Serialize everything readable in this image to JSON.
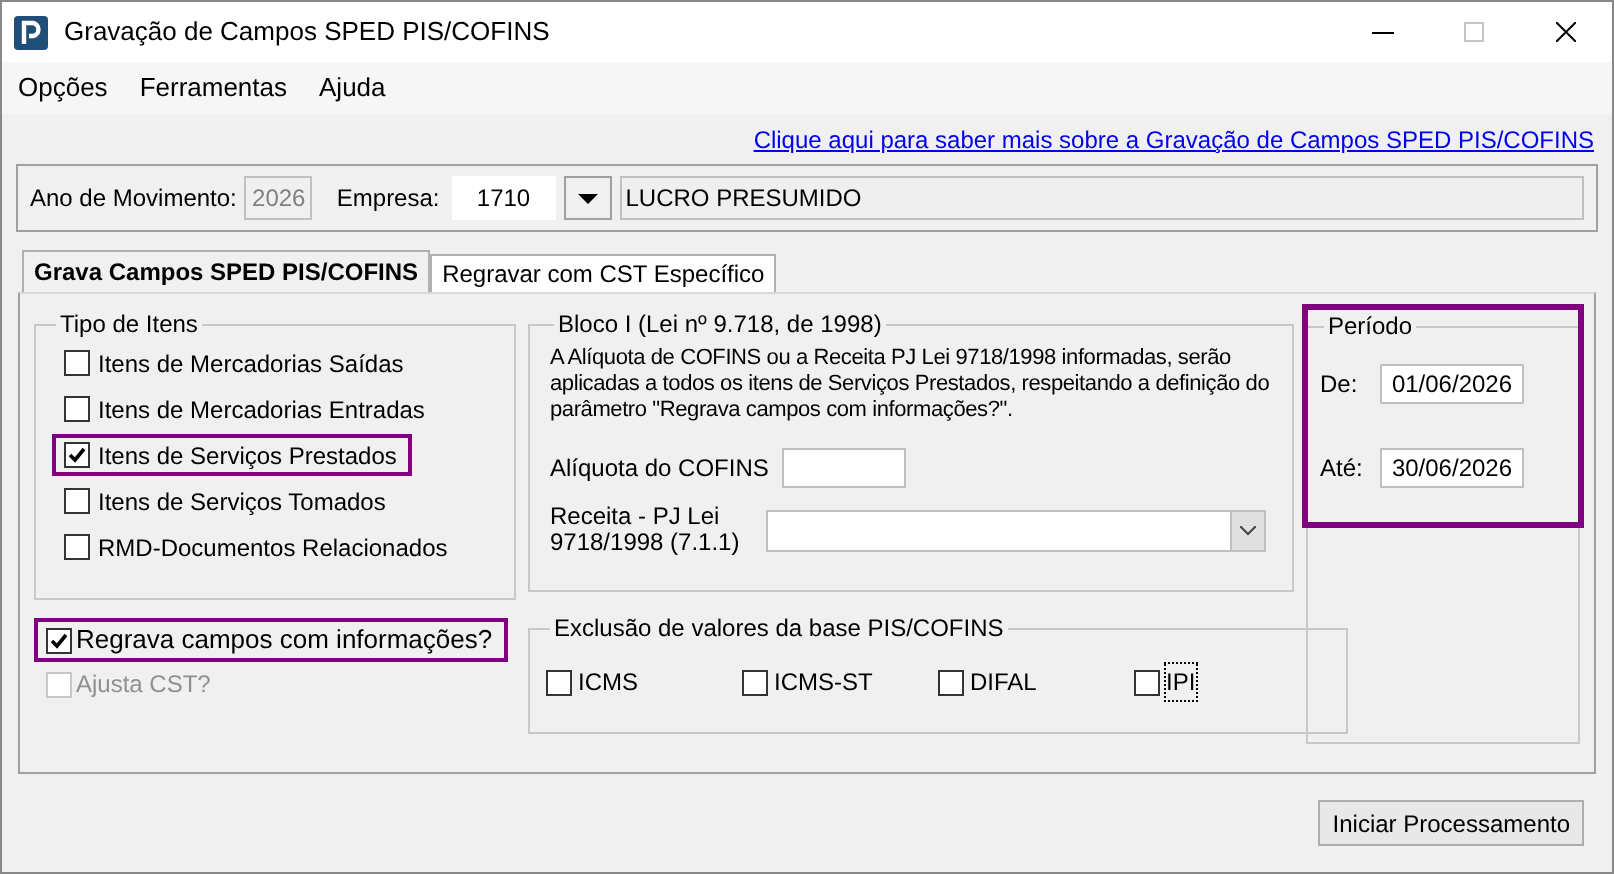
{
  "window": {
    "title": "Gravação de Campos SPED PIS/COFINS"
  },
  "menu": [
    "Opções",
    "Ferramentas",
    "Ajuda"
  ],
  "help_link": "Clique aqui para saber mais sobre a Gravação de Campos SPED PIS/COFINS",
  "header": {
    "ano_label": "Ano de Movimento:",
    "ano_value": "2026",
    "ano_disabled": true,
    "empresa_label": "Empresa:",
    "empresa_value": "1710",
    "empresa_name": "LUCRO PRESUMIDO"
  },
  "tabs": [
    {
      "label": "Grava Campos SPED PIS/COFINS",
      "selected": true
    },
    {
      "label": "Regravar com CST Específico",
      "selected": false
    }
  ],
  "tipo_itens": {
    "title": "Tipo de Itens",
    "items": [
      {
        "label": "Itens de Mercadorias Saídas",
        "checked": false,
        "highlighted": false
      },
      {
        "label": "Itens de Mercadorias Entradas",
        "checked": false,
        "highlighted": false
      },
      {
        "label": "Itens de Serviços Prestados",
        "checked": true,
        "highlighted": true
      },
      {
        "label": "Itens de Serviços Tomados",
        "checked": false,
        "highlighted": false
      },
      {
        "label": "RMD-Documentos Relacionados",
        "checked": false,
        "highlighted": false
      }
    ]
  },
  "options": [
    {
      "label": "Regrava campos com informações?",
      "checked": true,
      "disabled": false,
      "highlighted": true
    },
    {
      "label": "Ajusta CST?",
      "checked": false,
      "disabled": true,
      "highlighted": false
    }
  ],
  "bloco_i": {
    "title": "Bloco I (Lei nº 9.718, de 1998)",
    "description": "A Alíquota de COFINS ou a Receita PJ Lei 9718/1998 informadas, serão aplicadas a todos os itens de Serviços Prestados, respeitando a definição do parâmetro \"Regrava campos com informações?\".",
    "aliquota_label": "Alíquota do COFINS",
    "receita_label": "Receita - PJ Lei 9718/1998 (7.1.1)"
  },
  "exclusao": {
    "title": "Exclusão de valores da base PIS/COFINS",
    "items": [
      {
        "label": "ICMS",
        "checked": false,
        "focused": false
      },
      {
        "label": "ICMS-ST",
        "checked": false,
        "focused": false
      },
      {
        "label": "DIFAL",
        "checked": false,
        "focused": false
      },
      {
        "label": "IPI",
        "checked": false,
        "focused": true
      }
    ]
  },
  "periodo": {
    "title": "Período",
    "highlighted": true,
    "fields": [
      {
        "label": "De:",
        "value": "01/06/2026"
      },
      {
        "label": "Até:",
        "value": "30/06/2026"
      }
    ]
  },
  "buttons": [
    "Iniciar Processamento"
  ]
}
